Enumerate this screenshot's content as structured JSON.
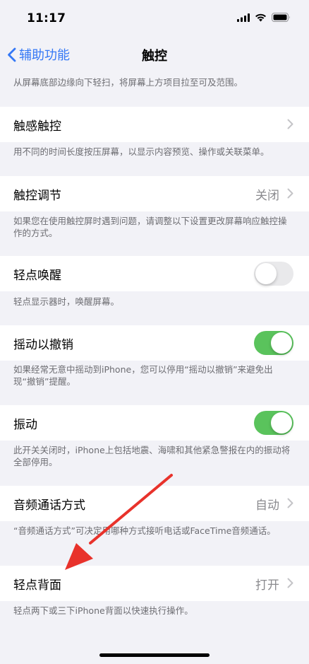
{
  "status": {
    "time": "11:17"
  },
  "nav": {
    "back_label": "辅助功能",
    "title": "触控"
  },
  "colors": {
    "accent": "#3478f6",
    "toggle_on": "#5ac35c",
    "annotation_arrow": "#e8322b"
  },
  "rows": {
    "reachability_footer": "从屏幕底部边缘向下轻扫，将屏幕上方项目拉至可及范围。",
    "haptic_touch": {
      "label": "触感触控"
    },
    "haptic_touch_footer": "用不同的时间长度按压屏幕，以显示内容预览、操作或关联菜单。",
    "touch_accommodations": {
      "label": "触控调节",
      "value": "关闭"
    },
    "touch_accommodations_footer": "如果您在使用触控屏时遇到问题，请调整以下设置更改屏幕响应触控操作的方式。",
    "tap_to_wake": {
      "label": "轻点唤醒",
      "on": false
    },
    "tap_to_wake_footer": "轻点显示器时，唤醒屏幕。",
    "shake_to_undo": {
      "label": "摇动以撤销",
      "on": true
    },
    "shake_to_undo_footer": "如果经常无意中摇动到iPhone，您可以停用“摇动以撤销”来避免出现“撤销”提醒。",
    "vibration": {
      "label": "振动",
      "on": true
    },
    "vibration_footer": "此开关关闭时，iPhone上包括地震、海啸和其他紧急警报在内的振动将全部停用。",
    "call_audio_routing": {
      "label": "音频通话方式",
      "value": "自动"
    },
    "call_audio_routing_footer": "“音频通话方式”可决定用哪种方式接听电话或FaceTime音频通话。",
    "back_tap": {
      "label": "轻点背面",
      "value": "打开"
    },
    "back_tap_footer": "轻点两下或三下iPhone背面以快速执行操作。"
  }
}
